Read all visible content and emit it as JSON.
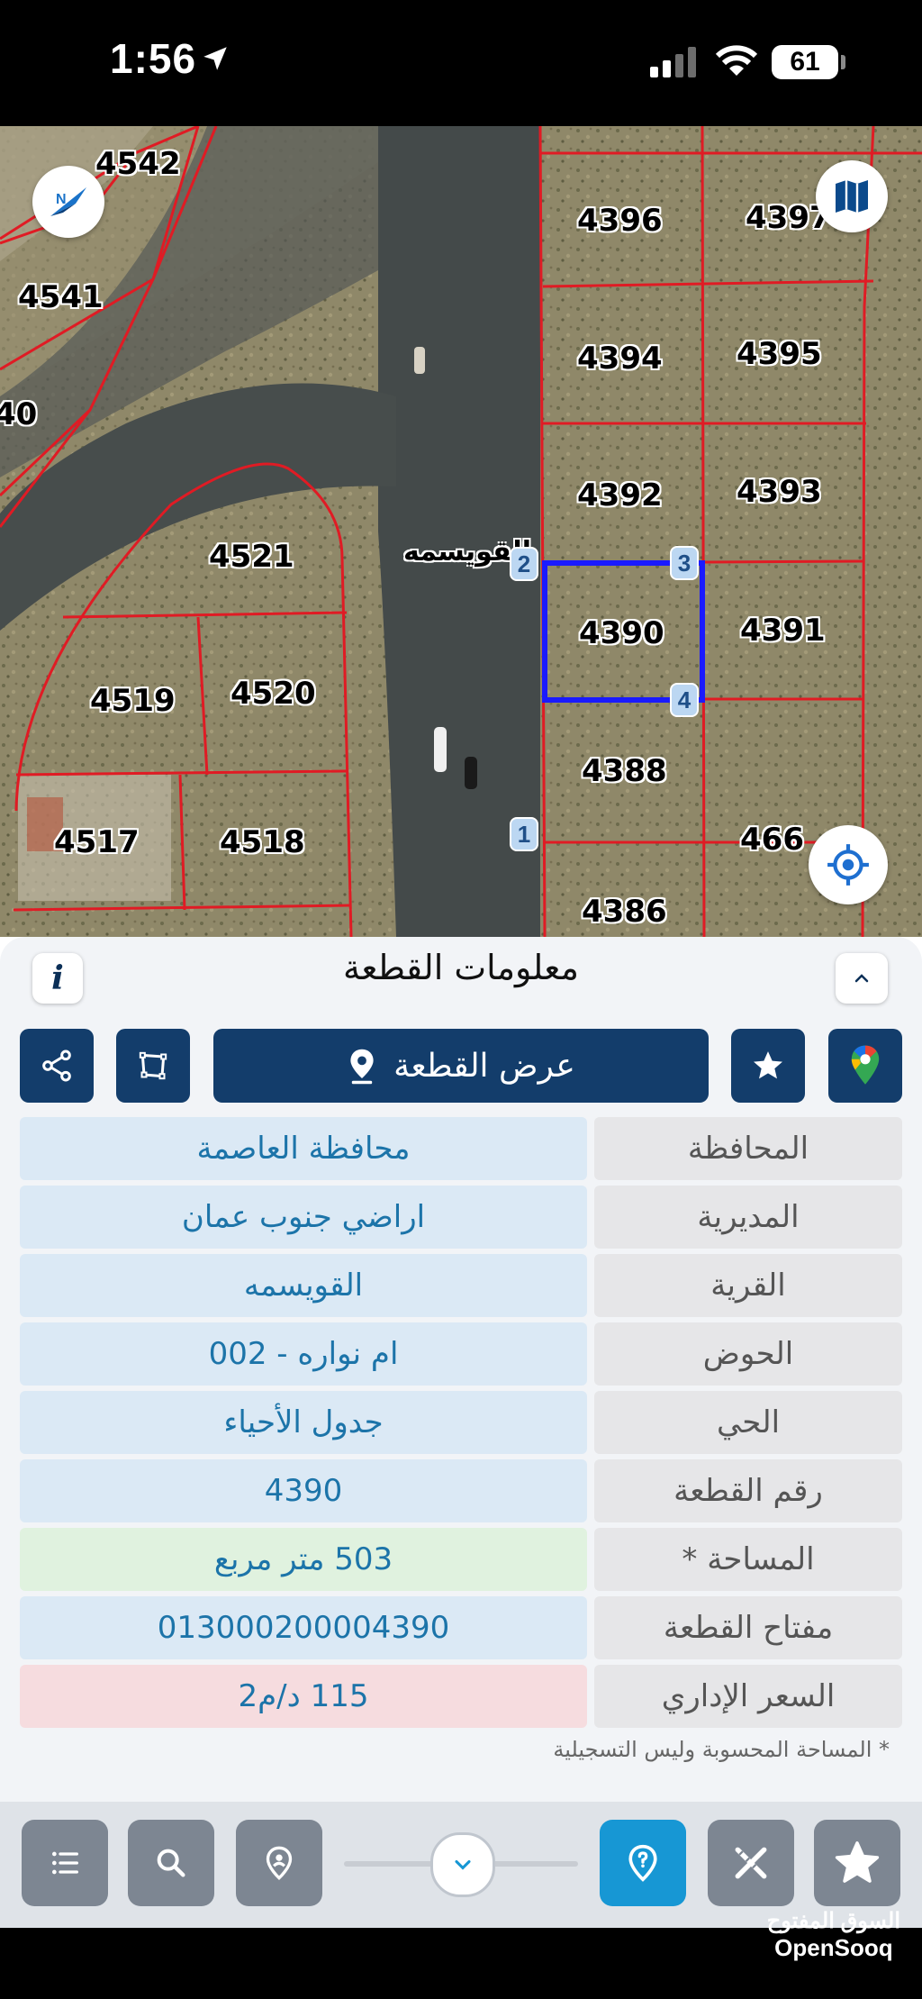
{
  "status_bar": {
    "time": "1:56",
    "battery": "61"
  },
  "map": {
    "plots": [
      {
        "id": "p4542",
        "label": "4542"
      },
      {
        "id": "p4541",
        "label": "4541"
      },
      {
        "id": "p40",
        "label": "40"
      },
      {
        "id": "p4521",
        "label": "4521"
      },
      {
        "id": "p4519",
        "label": "4519"
      },
      {
        "id": "p4520",
        "label": "4520"
      },
      {
        "id": "p4517",
        "label": "4517"
      },
      {
        "id": "p4518",
        "label": "4518"
      },
      {
        "id": "p4396",
        "label": "4396"
      },
      {
        "id": "p4397",
        "label": "4397"
      },
      {
        "id": "p4394",
        "label": "4394"
      },
      {
        "id": "p4395",
        "label": "4395"
      },
      {
        "id": "p4392",
        "label": "4392"
      },
      {
        "id": "p4393",
        "label": "4393"
      },
      {
        "id": "p4390",
        "label": "4390"
      },
      {
        "id": "p4391",
        "label": "4391"
      },
      {
        "id": "p4388",
        "label": "4388"
      },
      {
        "id": "p466",
        "label": "466"
      },
      {
        "id": "p4386",
        "label": "4386"
      }
    ],
    "village_label": "القويسمه",
    "corners": [
      "1",
      "2",
      "3",
      "4"
    ],
    "selected_color": "#1a1aff",
    "boundary_color": "#e01b24"
  },
  "panel": {
    "title": "معلومات القطعة",
    "view_plot_label": "عرض القطعة",
    "rows": [
      {
        "key": "المحافظة",
        "value": "محافظة العاصمة"
      },
      {
        "key": "المديرية",
        "value": "اراضي جنوب عمان"
      },
      {
        "key": "القرية",
        "value": "القويسمه"
      },
      {
        "key": "الحوض",
        "value": "ام نواره - 002"
      },
      {
        "key": "الحي",
        "value": "جدول الأحياء"
      },
      {
        "key": "رقم القطعة",
        "value": "4390"
      },
      {
        "key": "المساحة *",
        "value": "503   متر مربع"
      },
      {
        "key": "مفتاح القطعة",
        "value": "013000200004390"
      },
      {
        "key": "السعر الإداري",
        "value": "115 د/م2"
      }
    ],
    "footnote": "* المساحة المحسوبة وليس التسجيلية"
  },
  "watermark": {
    "arabic": "السوق المفتوح",
    "english": "OpenSooq"
  },
  "colors": {
    "navy": "#133d6b",
    "accent": "#1797d4"
  }
}
